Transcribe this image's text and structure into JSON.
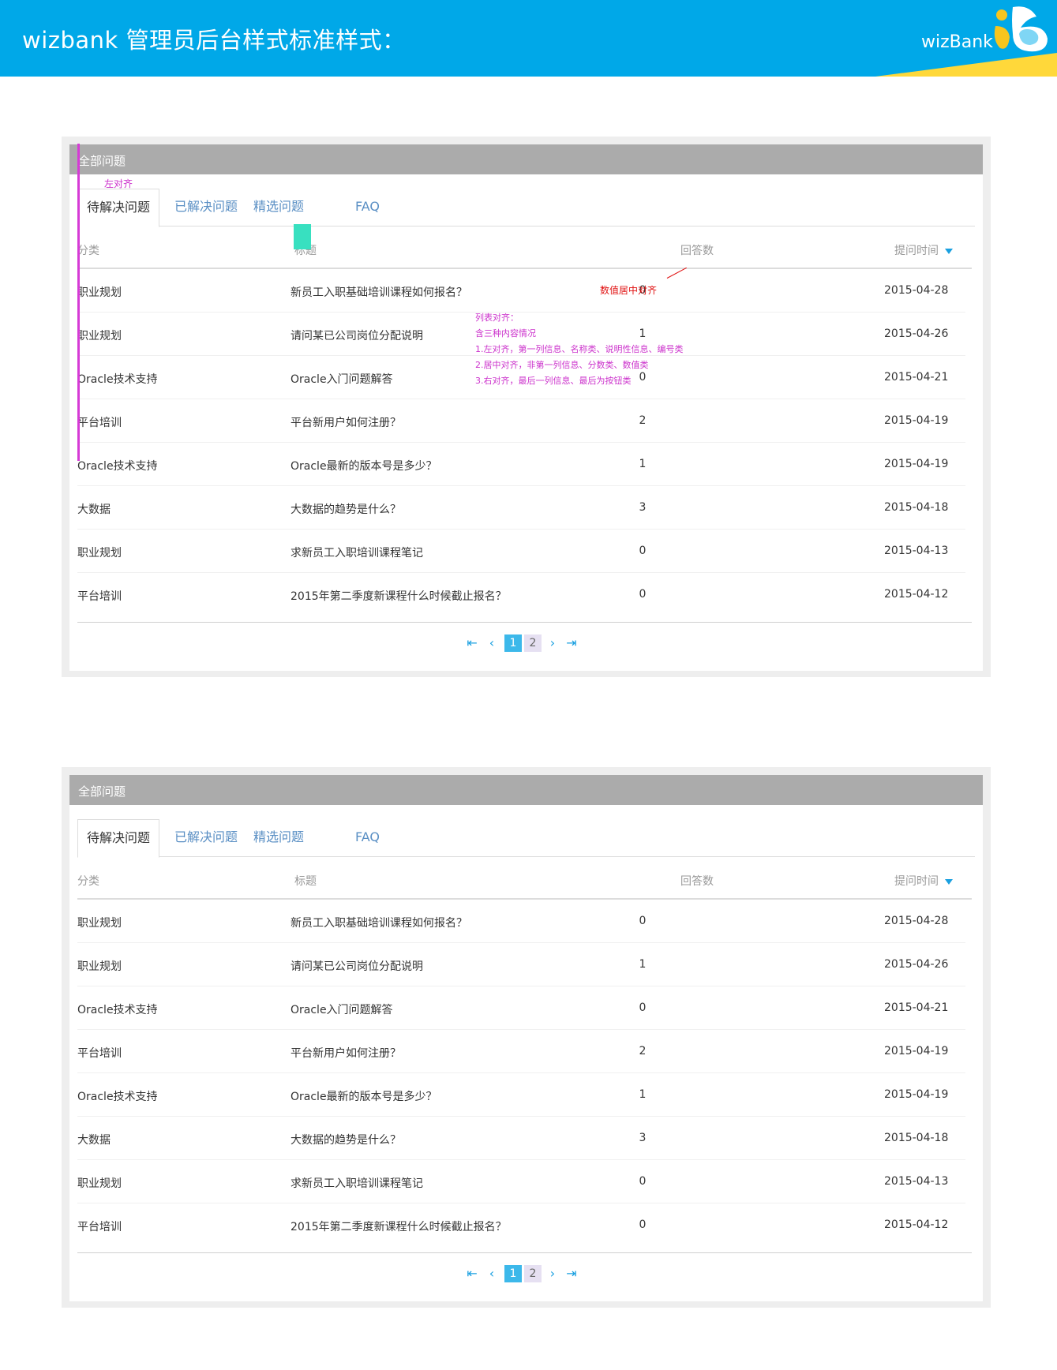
{
  "header": {
    "title": "wizbank 管理员后台样式标准样式：",
    "logo_text": "wizBank"
  },
  "panel": {
    "title": "全部问题",
    "tabs": [
      "待解决问题",
      "已解决问题",
      "精选问题",
      "FAQ"
    ],
    "columns": {
      "category": "分类",
      "title": "标题",
      "answers": "回答数",
      "time": "提问时间"
    },
    "rows": [
      {
        "category": "职业规划",
        "title": "新员工入职基础培训课程如何报名？",
        "answers": "0",
        "time": "2015-04-28"
      },
      {
        "category": "职业规划",
        "title": "请问某已公司岗位分配说明",
        "answers": "1",
        "time": "2015-04-26"
      },
      {
        "category": "Oracle技术支持",
        "title": "Oracle入门问题解答",
        "answers": "0",
        "time": "2015-04-21"
      },
      {
        "category": "平台培训",
        "title": "平台新用户如何注册？",
        "answers": "2",
        "time": "2015-04-19"
      },
      {
        "category": "Oracle技术支持",
        "title": "Oracle最新的版本号是多少？",
        "answers": "1",
        "time": "2015-04-19"
      },
      {
        "category": "大数据",
        "title": "大数据的趋势是什么？",
        "answers": "3",
        "time": "2015-04-18"
      },
      {
        "category": "职业规划",
        "title": "求新员工入职培训课程笔记",
        "answers": "0",
        "time": "2015-04-13"
      },
      {
        "category": "平台培训",
        "title": "2015年第二季度新课程什么时候截止报名？",
        "answers": "0",
        "time": "2015-04-12"
      }
    ],
    "pagination": {
      "first_icon": "first-page-icon",
      "prev_icon": "prev-page-icon",
      "next_icon": "next-page-icon",
      "last_icon": "last-page-icon",
      "pages": [
        "1",
        "2"
      ],
      "current_page": "1"
    }
  },
  "annotations": {
    "left_align": "左对齐",
    "center_number": "数值居中对齐",
    "list_align": [
      "列表对齐：",
      "含三种内容情况",
      "1.左对齐，第一列信息、名称类、说明性信息、编号类",
      "2.居中对齐，非第一列信息、分数类、数值类",
      "3.右对齐，最后一列信息、最后为按钮类"
    ]
  },
  "colors": {
    "header_bg": "#00a8e8",
    "accent_yellow": "#ffd83a",
    "panel_head_bg": "#ababab",
    "link_blue": "#5a8fc4",
    "pager_active": "#3cb8ea",
    "annotation_magenta": "#cc33cc",
    "annotation_red": "#e01010"
  }
}
